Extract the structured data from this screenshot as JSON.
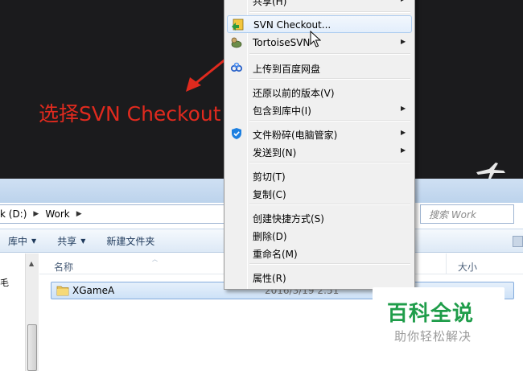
{
  "annotation": {
    "text": "选择SVN Checkout"
  },
  "context_menu": {
    "items": [
      {
        "label": "共享(H)",
        "has_submenu": true,
        "icon": ""
      },
      {
        "label": "SVN Checkout...",
        "has_submenu": false,
        "icon": "svn-checkout-icon",
        "highlighted": true
      },
      {
        "label": "TortoiseSVN",
        "has_submenu": true,
        "icon": "tortoise-icon"
      },
      {
        "label": "上传到百度网盘",
        "has_submenu": false,
        "icon": "baidu-netdisk-icon"
      },
      {
        "label": "还原以前的版本(V)",
        "has_submenu": false,
        "icon": ""
      },
      {
        "label": "包含到库中(I)",
        "has_submenu": true,
        "icon": ""
      },
      {
        "label": "文件粉碎(电脑管家)",
        "has_submenu": true,
        "icon": "shield-icon"
      },
      {
        "label": "发送到(N)",
        "has_submenu": true,
        "icon": ""
      },
      {
        "label": "剪切(T)",
        "has_submenu": false,
        "icon": ""
      },
      {
        "label": "复制(C)",
        "has_submenu": false,
        "icon": ""
      },
      {
        "label": "创建快捷方式(S)",
        "has_submenu": false,
        "icon": ""
      },
      {
        "label": "删除(D)",
        "has_submenu": false,
        "icon": ""
      },
      {
        "label": "重命名(M)",
        "has_submenu": false,
        "icon": ""
      },
      {
        "label": "属性(R)",
        "has_submenu": false,
        "icon": ""
      }
    ]
  },
  "explorer": {
    "breadcrumb": [
      "k (D:)",
      "Work"
    ],
    "search_placeholder": "搜索 Work",
    "toolbar": {
      "library": "库中",
      "share": "共享",
      "new_folder": "新建文件夹"
    },
    "columns": {
      "name": "名称",
      "size": "大小"
    },
    "nav_partial_char": "毛",
    "files": [
      {
        "name": "XGameA",
        "date": "2016/3/19 2:51"
      }
    ]
  },
  "watermark": {
    "title": "百科全说",
    "subtitle": "助你轻松解决"
  },
  "colors": {
    "annotation": "#e02a1e",
    "watermark_green": "#1f9d4a",
    "highlight_border": "#aecdf0"
  }
}
